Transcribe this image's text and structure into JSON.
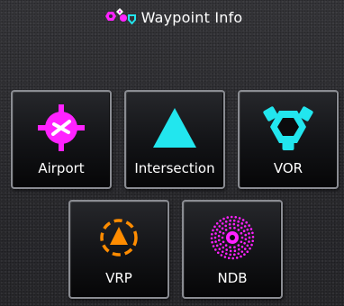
{
  "header": {
    "title": "Waypoint Info",
    "icon": "waypoint-cluster-icon"
  },
  "tiles": [
    {
      "label": "Airport",
      "icon": "airport-icon",
      "color": "#ff22ff"
    },
    {
      "label": "Intersection",
      "icon": "intersection-triangle-icon",
      "color": "#22e6ee"
    },
    {
      "label": "VOR",
      "icon": "vor-icon",
      "color": "#22e6ee"
    },
    {
      "label": "VRP",
      "icon": "vrp-icon",
      "color": "#ff8c00"
    },
    {
      "label": "NDB",
      "icon": "ndb-icon",
      "color": "#ff22ff"
    }
  ],
  "colors": {
    "magenta": "#ff22ff",
    "cyan": "#22e6ee",
    "orange": "#ff8c00",
    "tile_border": "#8a8c92",
    "background": "#2f2f33"
  }
}
